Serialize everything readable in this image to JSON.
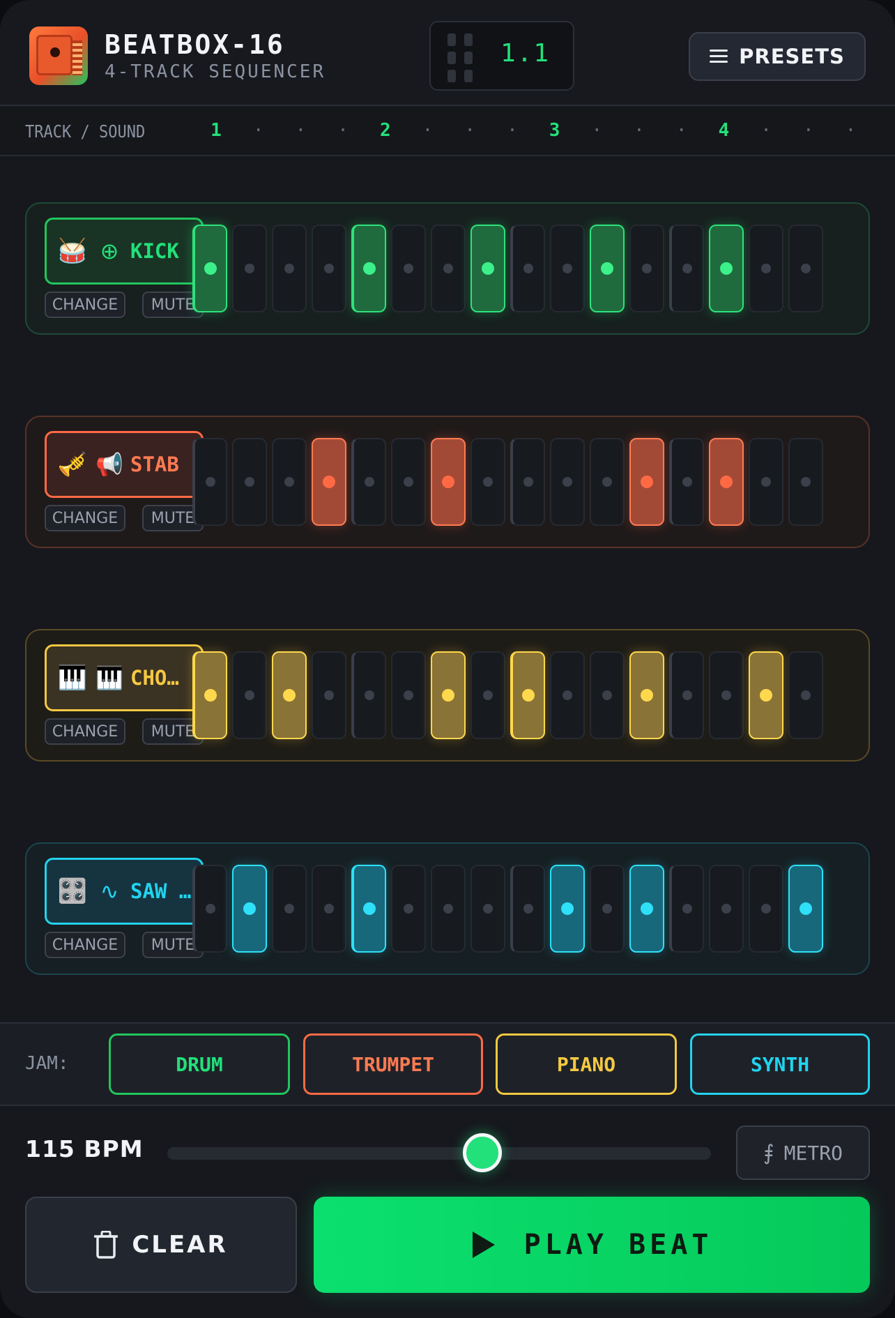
{
  "header": {
    "title": "BEATBOX-16",
    "subtitle": "4-TRACK SEQUENCER",
    "position": "1.1",
    "presets_label": "PRESETS"
  },
  "ruler": {
    "label": "TRACK / SOUND",
    "marks": [
      "1",
      "·",
      "·",
      "·",
      "2",
      "·",
      "·",
      "·",
      "3",
      "·",
      "·",
      "·",
      "4",
      "·",
      "·",
      "·"
    ]
  },
  "tracks": [
    {
      "name": "KICK",
      "emoji": "🥁",
      "symbol": "⊕",
      "color": "#22c55e",
      "change_label": "CHANGE",
      "mute_label": "MUTE",
      "steps": [
        1,
        0,
        0,
        0,
        1,
        0,
        0,
        1,
        0,
        0,
        1,
        0,
        0,
        1,
        0,
        0
      ]
    },
    {
      "name": "STAB",
      "emoji": "🎺",
      "symbol": "📢",
      "color": "#ff6a45",
      "change_label": "CHANGE",
      "mute_label": "MUTE",
      "steps": [
        0,
        0,
        0,
        1,
        0,
        0,
        1,
        0,
        0,
        0,
        0,
        1,
        0,
        1,
        0,
        0
      ]
    },
    {
      "name": "CHO…",
      "emoji": "🎹",
      "symbol": "🎹",
      "color": "#f5c842",
      "change_label": "CHANGE",
      "mute_label": "MUTE",
      "steps": [
        1,
        0,
        1,
        0,
        0,
        0,
        1,
        0,
        1,
        0,
        0,
        1,
        0,
        0,
        1,
        0
      ]
    },
    {
      "name": "SAW …",
      "emoji": "🎛️",
      "symbol": "∿",
      "color": "#22d3ee",
      "change_label": "CHANGE",
      "mute_label": "MUTE",
      "steps": [
        0,
        1,
        0,
        0,
        1,
        0,
        0,
        0,
        0,
        1,
        0,
        1,
        0,
        0,
        0,
        1
      ]
    }
  ],
  "jam": {
    "label": "JAM:",
    "buttons": [
      {
        "label": "DRUM",
        "color": "#22c55e"
      },
      {
        "label": "TRUMPET",
        "color": "#ff6a45"
      },
      {
        "label": "PIANO",
        "color": "#f5c842"
      },
      {
        "label": "SYNTH",
        "color": "#22d3ee"
      }
    ]
  },
  "tempo": {
    "bpm_label": "115 BPM",
    "slider_fraction": 0.58,
    "metro_label": "METRO"
  },
  "actions": {
    "clear_label": "CLEAR",
    "play_label": "PLAY BEAT"
  }
}
